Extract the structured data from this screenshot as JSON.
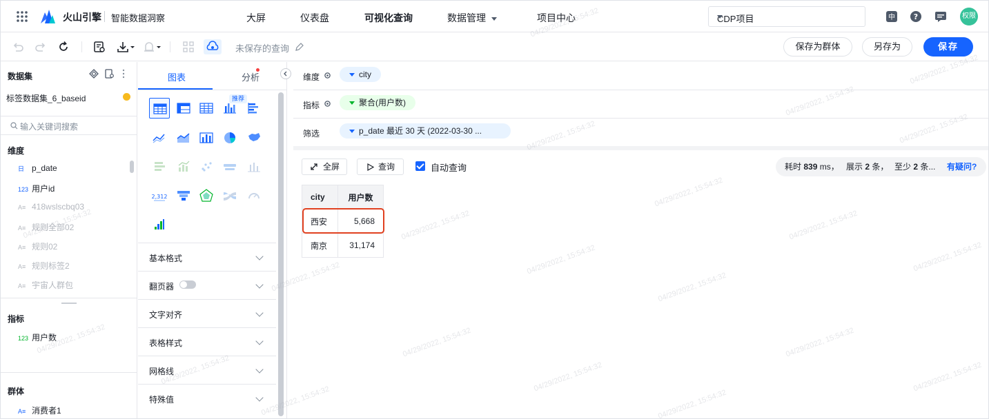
{
  "header": {
    "brand_name": "火山引擎",
    "product_name": "智能数据洞察",
    "nav": [
      "大屏",
      "仪表盘",
      "可视化查询",
      "数据管理",
      "项目中心"
    ],
    "project": "CDP项目",
    "avatar_text": "权限"
  },
  "toolbar": {
    "unsaved_label": "未保存的查询",
    "save_group_label": "保存为群体",
    "save_as_label": "另存为",
    "save_label": "保存"
  },
  "left_panel": {
    "title": "数据集",
    "dataset_name": "标签数据集_6_baseid",
    "search_placeholder": "输入关键词搜索",
    "dimensions_title": "维度",
    "dimensions": [
      {
        "type": "日",
        "name": "p_date"
      },
      {
        "type": "123",
        "name": "用户id"
      },
      {
        "type": "A≡",
        "name": "418wslscbq03"
      },
      {
        "type": "A≡",
        "name": "规则全部02"
      },
      {
        "type": "A≡",
        "name": "规则02"
      },
      {
        "type": "A≡",
        "name": "规则标签2"
      },
      {
        "type": "A≡",
        "name": "宇宙人群包"
      }
    ],
    "metrics_title": "指标",
    "metrics": [
      {
        "type": "123",
        "name": "用户数"
      }
    ],
    "groups_title": "群体",
    "groups": [
      {
        "type": "A≡",
        "name": "消费者1"
      }
    ]
  },
  "chart_panel": {
    "tabs": [
      "图表",
      "分析"
    ],
    "recommend_badge": "推荐",
    "kpi_sample": "2,312",
    "sections": [
      "基本格式",
      "翻页器",
      "文字对齐",
      "表格样式",
      "网格线",
      "特殊值"
    ]
  },
  "query": {
    "dimension_label": "维度",
    "dimension_value": "city",
    "metric_label": "指标",
    "metric_value": "聚合(用户数)",
    "filter_label": "筛选",
    "filter_value": "p_date 最近 30 天 (2022-03-30 ..."
  },
  "result": {
    "fullscreen_label": "全屏",
    "query_label": "查询",
    "auto_query_label": "自动查询",
    "stats": {
      "time_prefix": "耗时",
      "time_value": "839",
      "time_unit": "ms，",
      "show_prefix": "展示",
      "show_value": "2",
      "show_unit": "条，",
      "min_prefix": "至少",
      "min_value": "2",
      "min_unit": "条...",
      "help": "有疑问?"
    },
    "columns": [
      "city",
      "用户数"
    ],
    "rows": [
      [
        "西安",
        "5,668"
      ],
      [
        "南京",
        "31,174"
      ]
    ]
  },
  "watermark": "04/29/2022, 15:54:32",
  "colors": {
    "primary": "#1664ff",
    "highlight": "#e0401f",
    "avatar": "#36c29a"
  }
}
